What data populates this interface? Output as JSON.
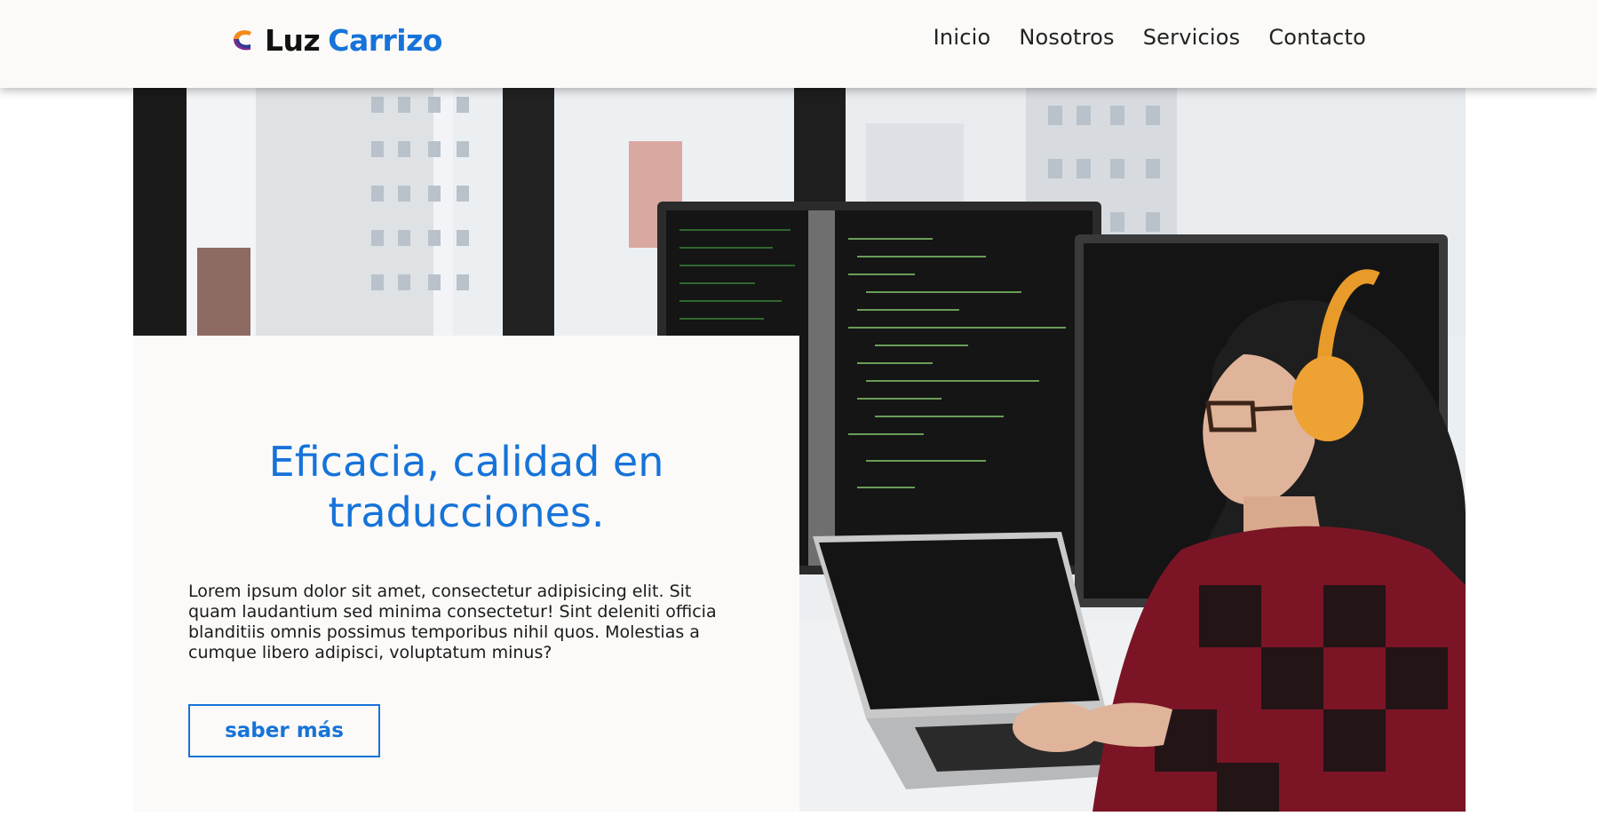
{
  "header": {
    "brand": {
      "logo_icon": "brand-c-logo-icon",
      "first": "Luz",
      "last": "Carrizo"
    },
    "nav": [
      "Inicio",
      "Nosotros",
      "Servicios",
      "Contacto"
    ]
  },
  "hero": {
    "image": "photo-of-woman-with-headphones-coding-at-desk-with-monitors-and-laptop",
    "title": "Eficacia, calidad en traducciones.",
    "body": "Lorem ipsum dolor sit amet, consectetur adipisicing elit. Sit quam laudantium sed minima consectetur! Sint deleniti officia blanditiis omnis possimus temporibus nihil quos. Molestias a cumque libero adipisci, voluptatum minus?",
    "button": "saber más"
  },
  "colors": {
    "accent": "#1673d9",
    "header_bg": "#fbfaf8",
    "card_bg": "#fbfaf8",
    "text": "#1b1b1b"
  }
}
